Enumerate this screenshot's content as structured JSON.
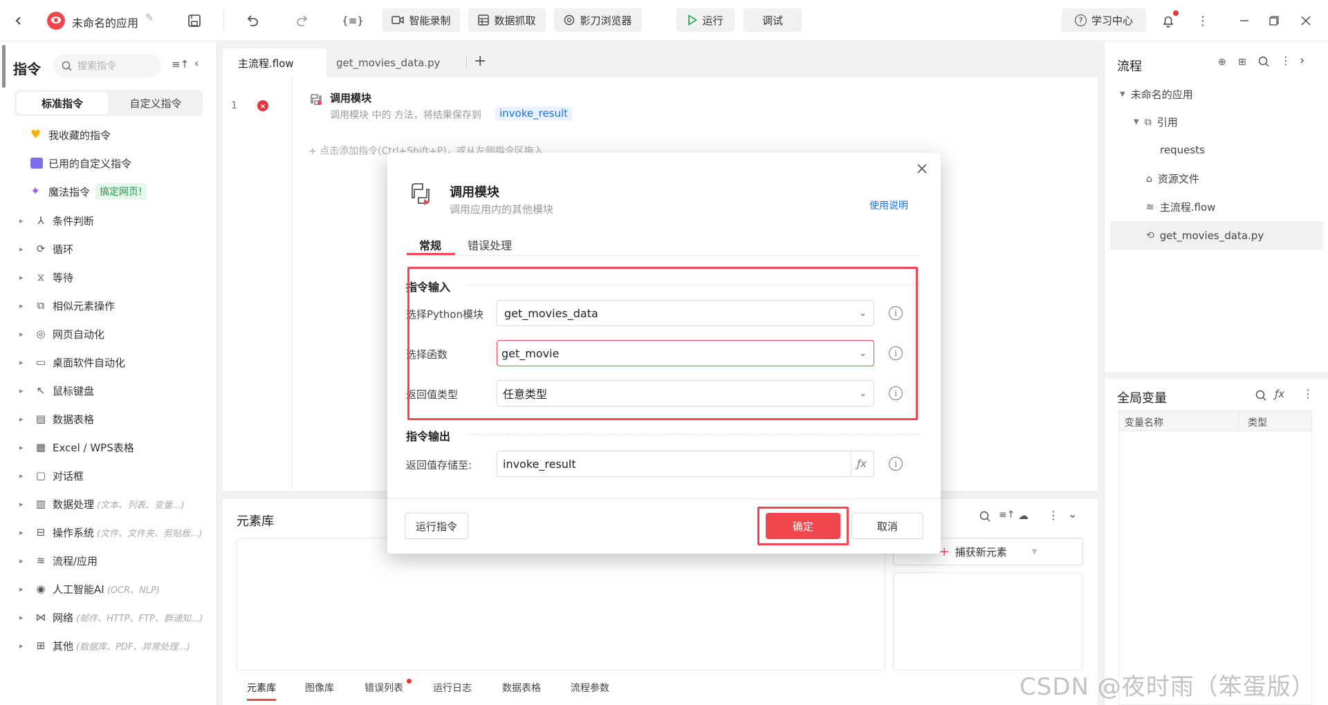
{
  "topbar": {
    "app_name": "未命名的应用",
    "buttons": [
      "智能录制",
      "数据抓取",
      "影刀浏览器"
    ],
    "run": "运行",
    "debug": "调试",
    "learn": "学习中心"
  },
  "left": {
    "title": "指令",
    "search_placeholder": "搜索指令",
    "tab_standard": "标准指令",
    "tab_custom": "自定义指令",
    "fav": "我收藏的指令",
    "used_custom": "已用的自定义指令",
    "magic": "魔法指令",
    "magic_badge": "搞定网页!",
    "categories": [
      {
        "label": "条件判断",
        "hint": ""
      },
      {
        "label": "循环",
        "hint": ""
      },
      {
        "label": "等待",
        "hint": ""
      },
      {
        "label": "相似元素操作",
        "hint": ""
      },
      {
        "label": "网页自动化",
        "hint": ""
      },
      {
        "label": "桌面软件自动化",
        "hint": ""
      },
      {
        "label": "鼠标键盘",
        "hint": ""
      },
      {
        "label": "数据表格",
        "hint": ""
      },
      {
        "label": "Excel / WPS表格",
        "hint": ""
      },
      {
        "label": "对话框",
        "hint": ""
      },
      {
        "label": "数据处理",
        "hint": "(文本、列表、变量...)"
      },
      {
        "label": "操作系统",
        "hint": "(文件、文件夹、剪贴板...)"
      },
      {
        "label": "流程/应用",
        "hint": ""
      },
      {
        "label": "人工智能AI",
        "hint": "(OCR、NLP)"
      },
      {
        "label": "网络",
        "hint": "(邮件、HTTP、FTP、群通知...)"
      },
      {
        "label": "其他",
        "hint": "(数据库、PDF、异常处理...)"
      }
    ]
  },
  "editor": {
    "tab_main": "主流程.flow",
    "tab_py": "get_movies_data.py",
    "line_no": "1",
    "step_title": "调用模块",
    "step_desc": "调用模块 中的 方法，将结果保存到",
    "step_var": "invoke_result",
    "add_hint": "点击添加指令(Ctrl+Shift+P)，或从左侧指令区拖入"
  },
  "element_lib": {
    "title": "元素库",
    "capture": "捕获新元素",
    "tabs": [
      "元素库",
      "图像库",
      "错误列表",
      "运行日志",
      "数据表格",
      "流程参数"
    ]
  },
  "right": {
    "flow_title": "流程",
    "app_node": "未命名的应用",
    "ref_node": "引用",
    "requests": "requests",
    "resources": "资源文件",
    "main_flow": "主流程.flow",
    "py_file": "get_movies_data.py",
    "globals_title": "全局变量",
    "col_name": "变量名称",
    "col_type": "类型"
  },
  "dialog": {
    "title": "调用模块",
    "subtitle": "调用应用内的其他模块",
    "help": "使用说明",
    "tab_general": "常规",
    "tab_error": "错误处理",
    "section_in": "指令输入",
    "label_module": "选择Python模块",
    "value_module": "get_movies_data",
    "label_func": "选择函数",
    "value_func": "get_movie",
    "label_ret": "返回值类型",
    "value_ret": "任意类型",
    "section_out": "指令输出",
    "label_save": "返回值存储至:",
    "value_save": "invoke_result",
    "run_btn": "运行指令",
    "ok": "确定",
    "cancel": "取消"
  },
  "watermark": "CSDN @夜时雨（笨蛋版）",
  "colors": {
    "accent": "#f0474e",
    "link": "#1a73e8",
    "highlight_box": "#f0474e"
  }
}
